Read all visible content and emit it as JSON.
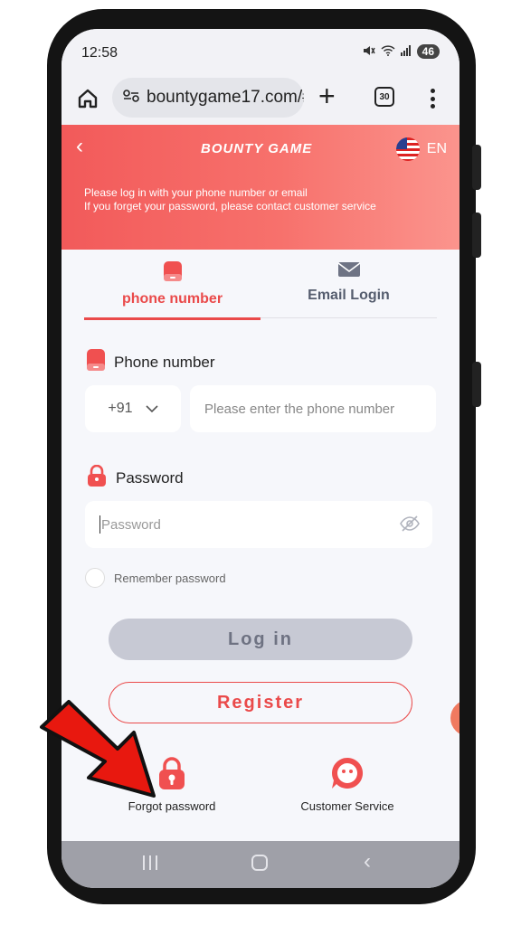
{
  "status": {
    "time": "12:58",
    "battery": "46"
  },
  "browser": {
    "url": "bountygame17.com/#",
    "tab_count": "30"
  },
  "header": {
    "brand": "BOUNTY GAME",
    "language": "EN",
    "subtitle_line1": "Please log in with your phone number or email",
    "subtitle_line2": "If you forget your password, please contact customer service"
  },
  "tabs": {
    "phone_label": "phone number",
    "email_label": "Email Login"
  },
  "form": {
    "phone_label": "Phone number",
    "country_code": "+91",
    "phone_placeholder": "Please enter the phone number",
    "password_label": "Password",
    "password_placeholder": "Password",
    "remember_label": "Remember password",
    "login_button": "Log in",
    "register_button": "Register"
  },
  "footer": {
    "forgot_label": "Forgot password",
    "service_label": "Customer Service"
  },
  "colors": {
    "accent": "#ea4a4a",
    "hero_start": "#f25a5a",
    "hero_end": "#fb948d",
    "disabled_button": "#c7c9d4"
  }
}
